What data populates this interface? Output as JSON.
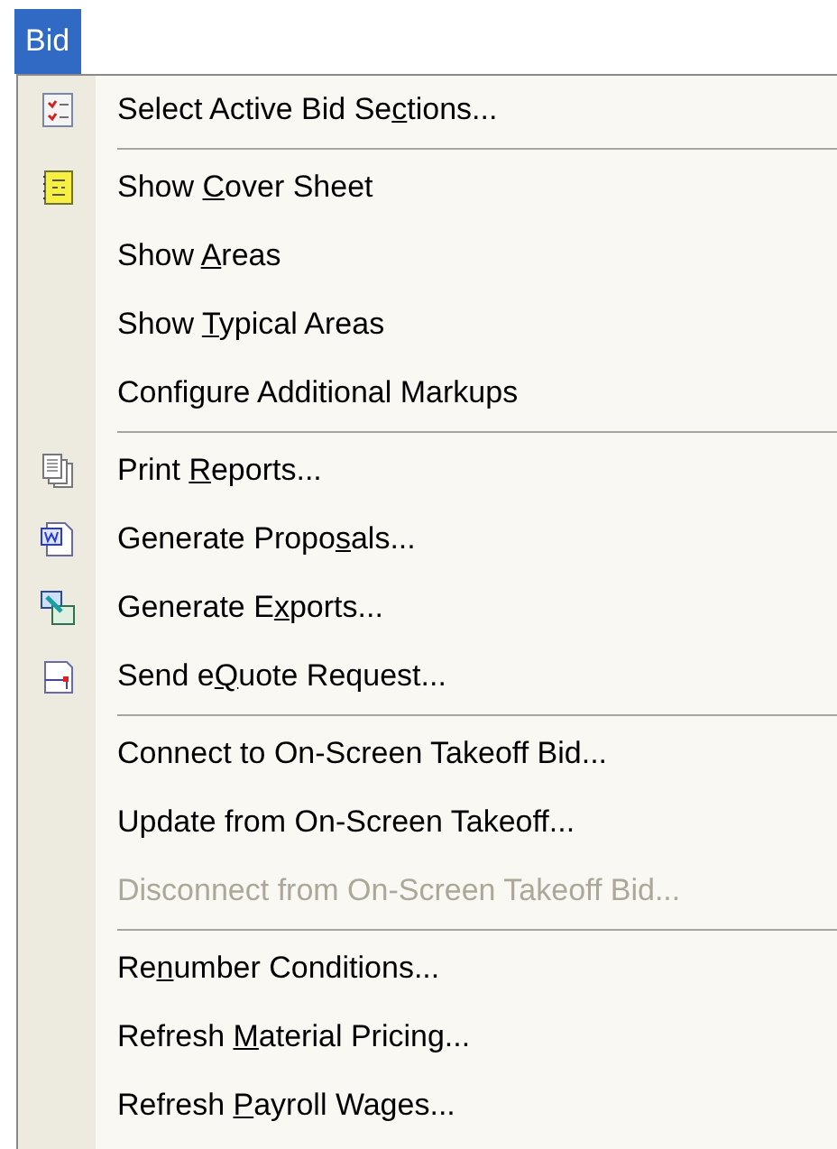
{
  "menu_bar": [
    {
      "label": "Bid",
      "selected": true
    }
  ],
  "menu": [
    {
      "kind": "item",
      "pre": "Select Active Bid Se",
      "key": "c",
      "post": "tions...",
      "disabled": false
    },
    {
      "kind": "separator"
    },
    {
      "kind": "item",
      "pre": "Show ",
      "key": "C",
      "post": "over Sheet",
      "disabled": false
    },
    {
      "kind": "item",
      "pre": "Show ",
      "key": "A",
      "post": "reas",
      "disabled": false
    },
    {
      "kind": "item",
      "pre": "Show ",
      "key": "T",
      "post": "ypical Areas",
      "disabled": false
    },
    {
      "kind": "item",
      "pre": "Configure Additional Markups",
      "disabled": false
    },
    {
      "kind": "separator"
    },
    {
      "kind": "item",
      "pre": "Print ",
      "key": "R",
      "post": "eports...",
      "disabled": false
    },
    {
      "kind": "item",
      "pre": "Generate Propo",
      "key": "s",
      "post": "als...",
      "disabled": false
    },
    {
      "kind": "item",
      "pre": "Generate E",
      "key": "x",
      "post": "ports...",
      "disabled": false
    },
    {
      "kind": "item",
      "pre": "Send e",
      "key": "Q",
      "post": "uote Request...",
      "disabled": false
    },
    {
      "kind": "separator"
    },
    {
      "kind": "item",
      "pre": "Connect to On-Screen Takeoff Bid...",
      "disabled": false
    },
    {
      "kind": "item",
      "pre": "Update from On-Screen Takeoff...",
      "disabled": false
    },
    {
      "kind": "item",
      "pre": "Disconnect from On-Screen Takeoff Bid...",
      "disabled": true
    },
    {
      "kind": "separator"
    },
    {
      "kind": "item",
      "pre": "Re",
      "key": "n",
      "post": "umber Conditions...",
      "disabled": false
    },
    {
      "kind": "item",
      "pre": "Refresh ",
      "key": "M",
      "post": "aterial Pricing...",
      "disabled": false
    },
    {
      "kind": "item",
      "pre": "Refresh ",
      "key": "P",
      "post": "ayroll Wages...",
      "disabled": false
    }
  ]
}
